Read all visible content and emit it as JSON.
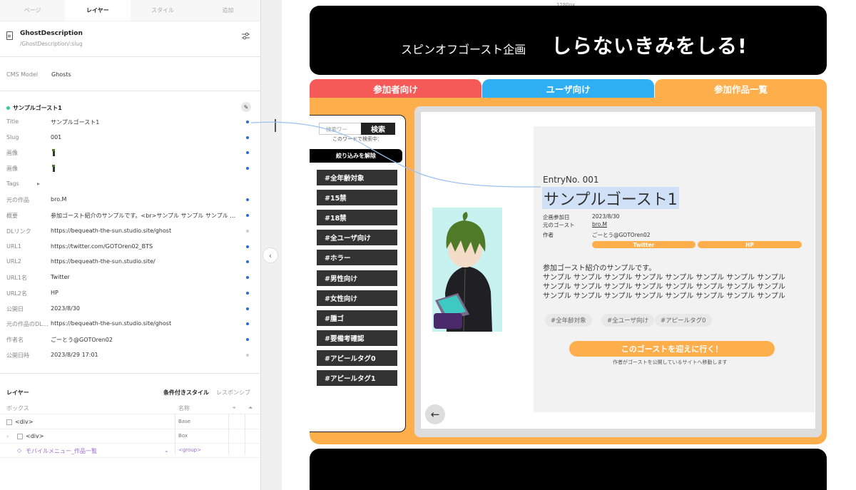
{
  "colors": {
    "accent": "#2a6dd9",
    "orange": "#ffae4c",
    "red": "#f65a58",
    "blue": "#2eaef3",
    "black": "#000000"
  },
  "panel": {
    "tabs": [
      {
        "label": "ページ"
      },
      {
        "label": "レイヤー",
        "active": true
      },
      {
        "label": "スタイル"
      },
      {
        "label": "追加"
      }
    ],
    "page_title": "GhostDescription",
    "page_slug": "/GhostDescription/:slug",
    "cms_model_label": "CMS Model",
    "cms_model_value": "Ghosts",
    "item_title": "サンプルゴースト1",
    "fields": [
      {
        "key": "Title",
        "value": "サンプルゴースト1"
      },
      {
        "key": "Slug",
        "value": "001"
      },
      {
        "key": "画像",
        "value": ""
      },
      {
        "key": "画像",
        "value": ""
      },
      {
        "key": "Tags",
        "value": ""
      },
      {
        "key": "元の作品",
        "value": "bro.M"
      },
      {
        "key": "概要",
        "value": "参加ゴースト紹介のサンプルです。<br>サンプル サンプル サンプル サンプ..."
      },
      {
        "key": "DLリンク",
        "value": "https://bequeath-the-sun.studio.site/ghost"
      },
      {
        "key": "URL1",
        "value": "https://twitter.com/GOTOren02_BTS"
      },
      {
        "key": "URL2",
        "value": "https://bequeath-the-sun.studio.site/"
      },
      {
        "key": "URL1名",
        "value": "Twitter"
      },
      {
        "key": "URL2名",
        "value": "HP"
      },
      {
        "key": "公開日",
        "value": "2023/8/30"
      },
      {
        "key": "元の作品のDLリ...",
        "value": "https://bequeath-the-sun.studio.site/ghost"
      },
      {
        "key": "作者名",
        "value": "ごーとう@GOTOren02"
      },
      {
        "key": "公開日時",
        "value": "2023/8/29 17:01"
      }
    ],
    "layers": {
      "heading": "レイヤー",
      "conditional_style": "条件付きスタイル",
      "responsive": "レスポンシブ",
      "col_box": "ボックス",
      "col_name": "名称",
      "rows": [
        {
          "name": "<div>",
          "class": "Base"
        },
        {
          "name": "<div>",
          "class": "Box"
        },
        {
          "name": "モバイルメニュー_作品一覧",
          "class": "<group>"
        }
      ]
    }
  },
  "canvas": {
    "width_label": "1280px",
    "header_sub": "スピンオフゴースト企画",
    "header_title": "しらないきみをしる!",
    "nav": [
      {
        "label": "参加者向け"
      },
      {
        "label": "ユーザ向け"
      },
      {
        "label": "参加作品一覧"
      }
    ],
    "search_placeholder": "検索ワー",
    "search_button": "検索",
    "searching_text": "このワードで検索中：",
    "clear_filter": "絞り込みを解除",
    "tags": [
      "#全年齢対象",
      "#15禁",
      "#18禁",
      "#全ユーザ向け",
      "#ホラー",
      "#男性向け",
      "#女性向け",
      "#腫ゴ",
      "#要備考確認",
      "#アピールタグ0",
      "#アピールタグ1"
    ],
    "entry_no": "EntryNo. 001",
    "ghost_name": "サンプルゴースト1",
    "meta": [
      {
        "k": "企画参加日",
        "v": "2023/8/30"
      },
      {
        "k": "元のゴースト",
        "v": "bro.M"
      },
      {
        "k": "作者",
        "v": "ごーとう@GOTOren02"
      }
    ],
    "link1": "Twitter",
    "link2": "HP",
    "desc_lead": "参加ゴースト紹介のサンプルです。",
    "desc_lines": [
      "サンプル サンプル サンプル サンプル サンプル サンプル サンプル サンプル",
      "サンプル サンプル サンプル サンプル サンプル サンプル サンプル サンプル",
      "サンプル サンプル サンプル サンプル サンプル サンプル サンプル サンプル"
    ],
    "chips": [
      "#全年齢対象",
      "#全ユーザ向け",
      "#アピールタグ0"
    ],
    "cta": "このゴーストを迎えに行く！",
    "cta_note": "作者がゴーストを公開しているサイトへ移動します",
    "back_arrow": "←"
  }
}
